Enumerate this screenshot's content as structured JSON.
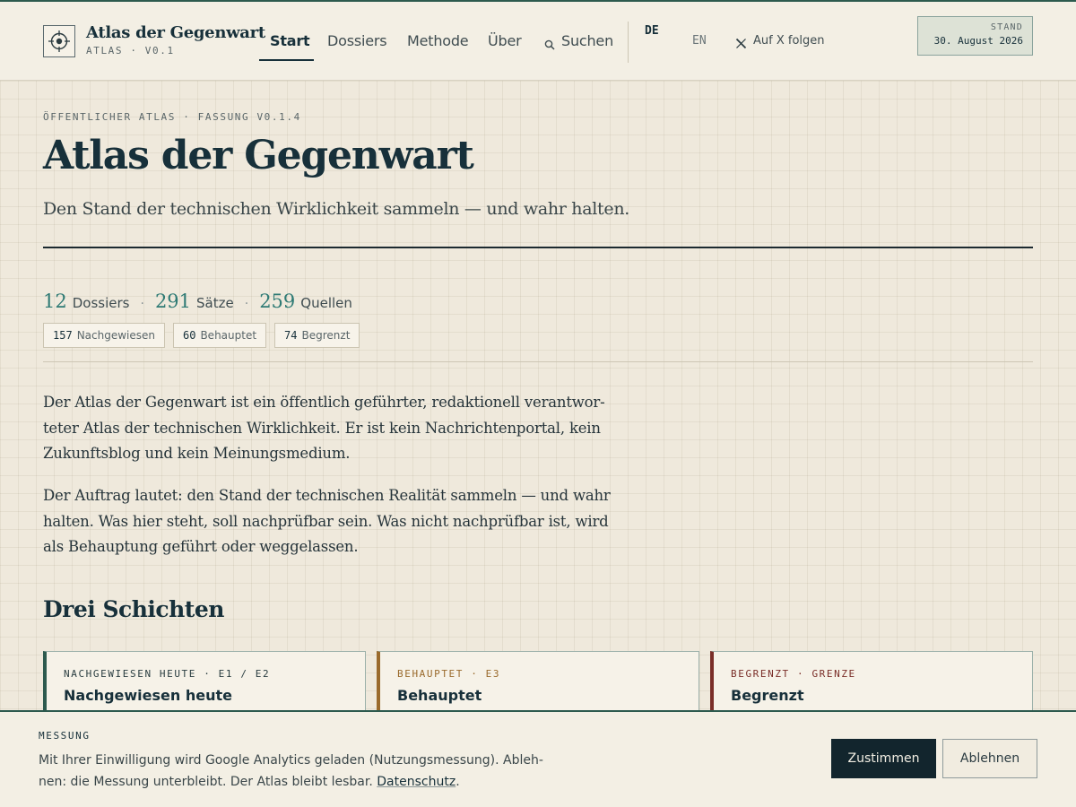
{
  "header": {
    "brand_title": "Atlas der Gegenwart",
    "brand_sub": "ATLAS · V0.1",
    "nav": {
      "start": "Start",
      "dossiers": "Dossiers",
      "methode": "Methode",
      "ueber": "Über",
      "suchen": "Suchen"
    },
    "lang_de": "DE",
    "lang_en": "EN",
    "x_follow": "Auf X folgen",
    "stand_label": "STAND",
    "stand_date": "30. August 2026"
  },
  "main": {
    "kicker": "ÖFFENTLICHER ATLAS · FASSUNG V0.1.4",
    "title": "Atlas der Gegenwart",
    "tagline": "Den Stand der technischen Wirklichkeit sammeln — und wahr halten.",
    "stats": {
      "dossiers_num": "12",
      "dossiers_label": "Dossiers",
      "saetze_num": "291",
      "saetze_label": "Sätze",
      "quellen_num": "259",
      "quellen_label": "Quellen",
      "separator": "·"
    },
    "chips": {
      "nachgewiesen_num": "157",
      "nachgewiesen_label": "Nachgewiesen",
      "behauptet_num": "60",
      "behauptet_label": "Behauptet",
      "begrenzt_num": "74",
      "begrenzt_label": "Begrenzt"
    },
    "para1_lines": [
      "Der Atlas der Gegenwart ist ein öffentlich geführter, redaktionell verantwor-",
      "teter Atlas der technischen Wirklichkeit. Er ist kein Nachrichtenportal, kein",
      "Zukunftsblog und kein Meinungsmedium."
    ],
    "para2_lines": [
      "Der Auftrag lautet: den Stand der technischen Realität sammeln — und wahr",
      "halten. Was hier steht, soll nachprüfbar sein. Was nicht nachprüfbar ist, wird",
      "als Behauptung geführt oder weggelassen."
    ],
    "section_title": "Drei Schichten",
    "cards": [
      {
        "kicker": "NACHGEWIESEN HEUTE · E1 / E2",
        "title": "Nachgewiesen heute"
      },
      {
        "kicker": "BEHAUPTET · E3",
        "title": "Behauptet"
      },
      {
        "kicker": "BEGRENZT · GRENZE",
        "title": "Begrenzt"
      }
    ]
  },
  "banner": {
    "kicker": "MESSUNG",
    "text_line1": "Mit Ihrer Einwilligung wird Google Analytics geladen (Nutzungsmessung). Ableh-",
    "text_line2": "nen: die Messung unterbleibt. Der Atlas bleibt lesbar.",
    "link": "Datenschutz",
    "period": ".",
    "accept": "Zustimmen",
    "decline": "Ablehnen"
  },
  "colors": {
    "accent": "#2d5a4e",
    "number_accent": "#2e7a74",
    "behauptet": "#9a6a2c",
    "begrenzt": "#7a2e28",
    "ink": "#17303a"
  }
}
